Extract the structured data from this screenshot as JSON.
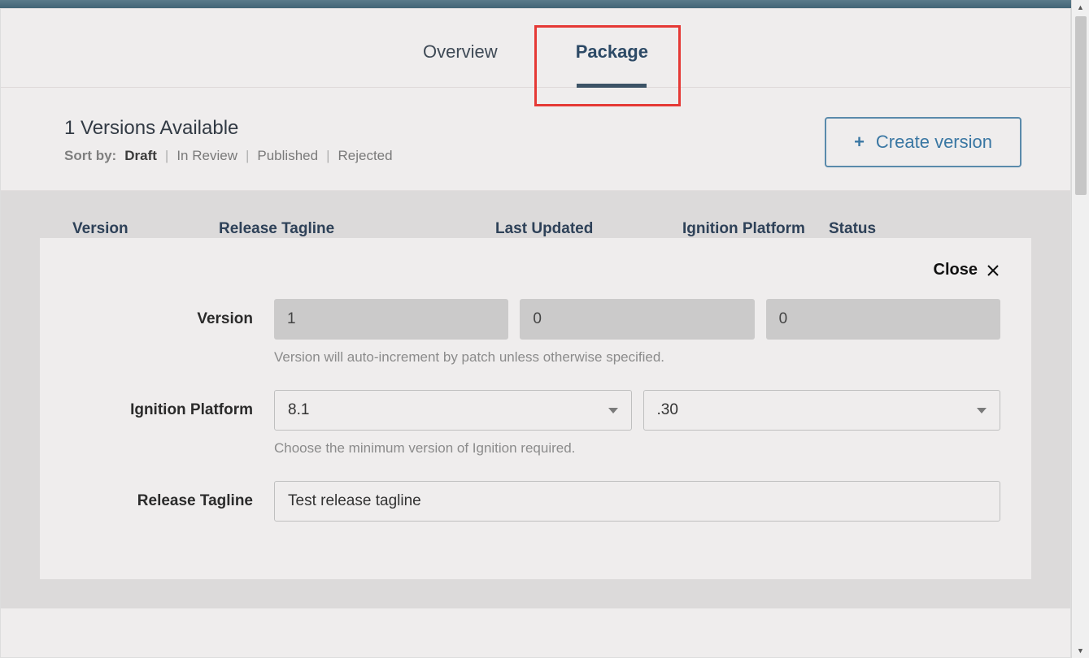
{
  "tabs": {
    "overview": "Overview",
    "package": "Package"
  },
  "header": {
    "versions_count": "1 Versions Available",
    "sort_by_label": "Sort by:",
    "sort_options": [
      "Draft",
      "In Review",
      "Published",
      "Rejected"
    ],
    "create_button": "Create version"
  },
  "columns": {
    "version": "Version",
    "tagline": "Release Tagline",
    "updated": "Last Updated",
    "platform": "Ignition Platform",
    "status": "Status"
  },
  "form": {
    "close_label": "Close",
    "version_label": "Version",
    "version_major": "1",
    "version_minor": "0",
    "version_patch": "0",
    "version_hint": "Version will auto-increment by patch unless otherwise specified.",
    "platform_label": "Ignition Platform",
    "platform_major": "8.1",
    "platform_minor": ".30",
    "platform_hint": "Choose the minimum version of Ignition required.",
    "tagline_label": "Release Tagline",
    "tagline_value": "Test release tagline"
  }
}
